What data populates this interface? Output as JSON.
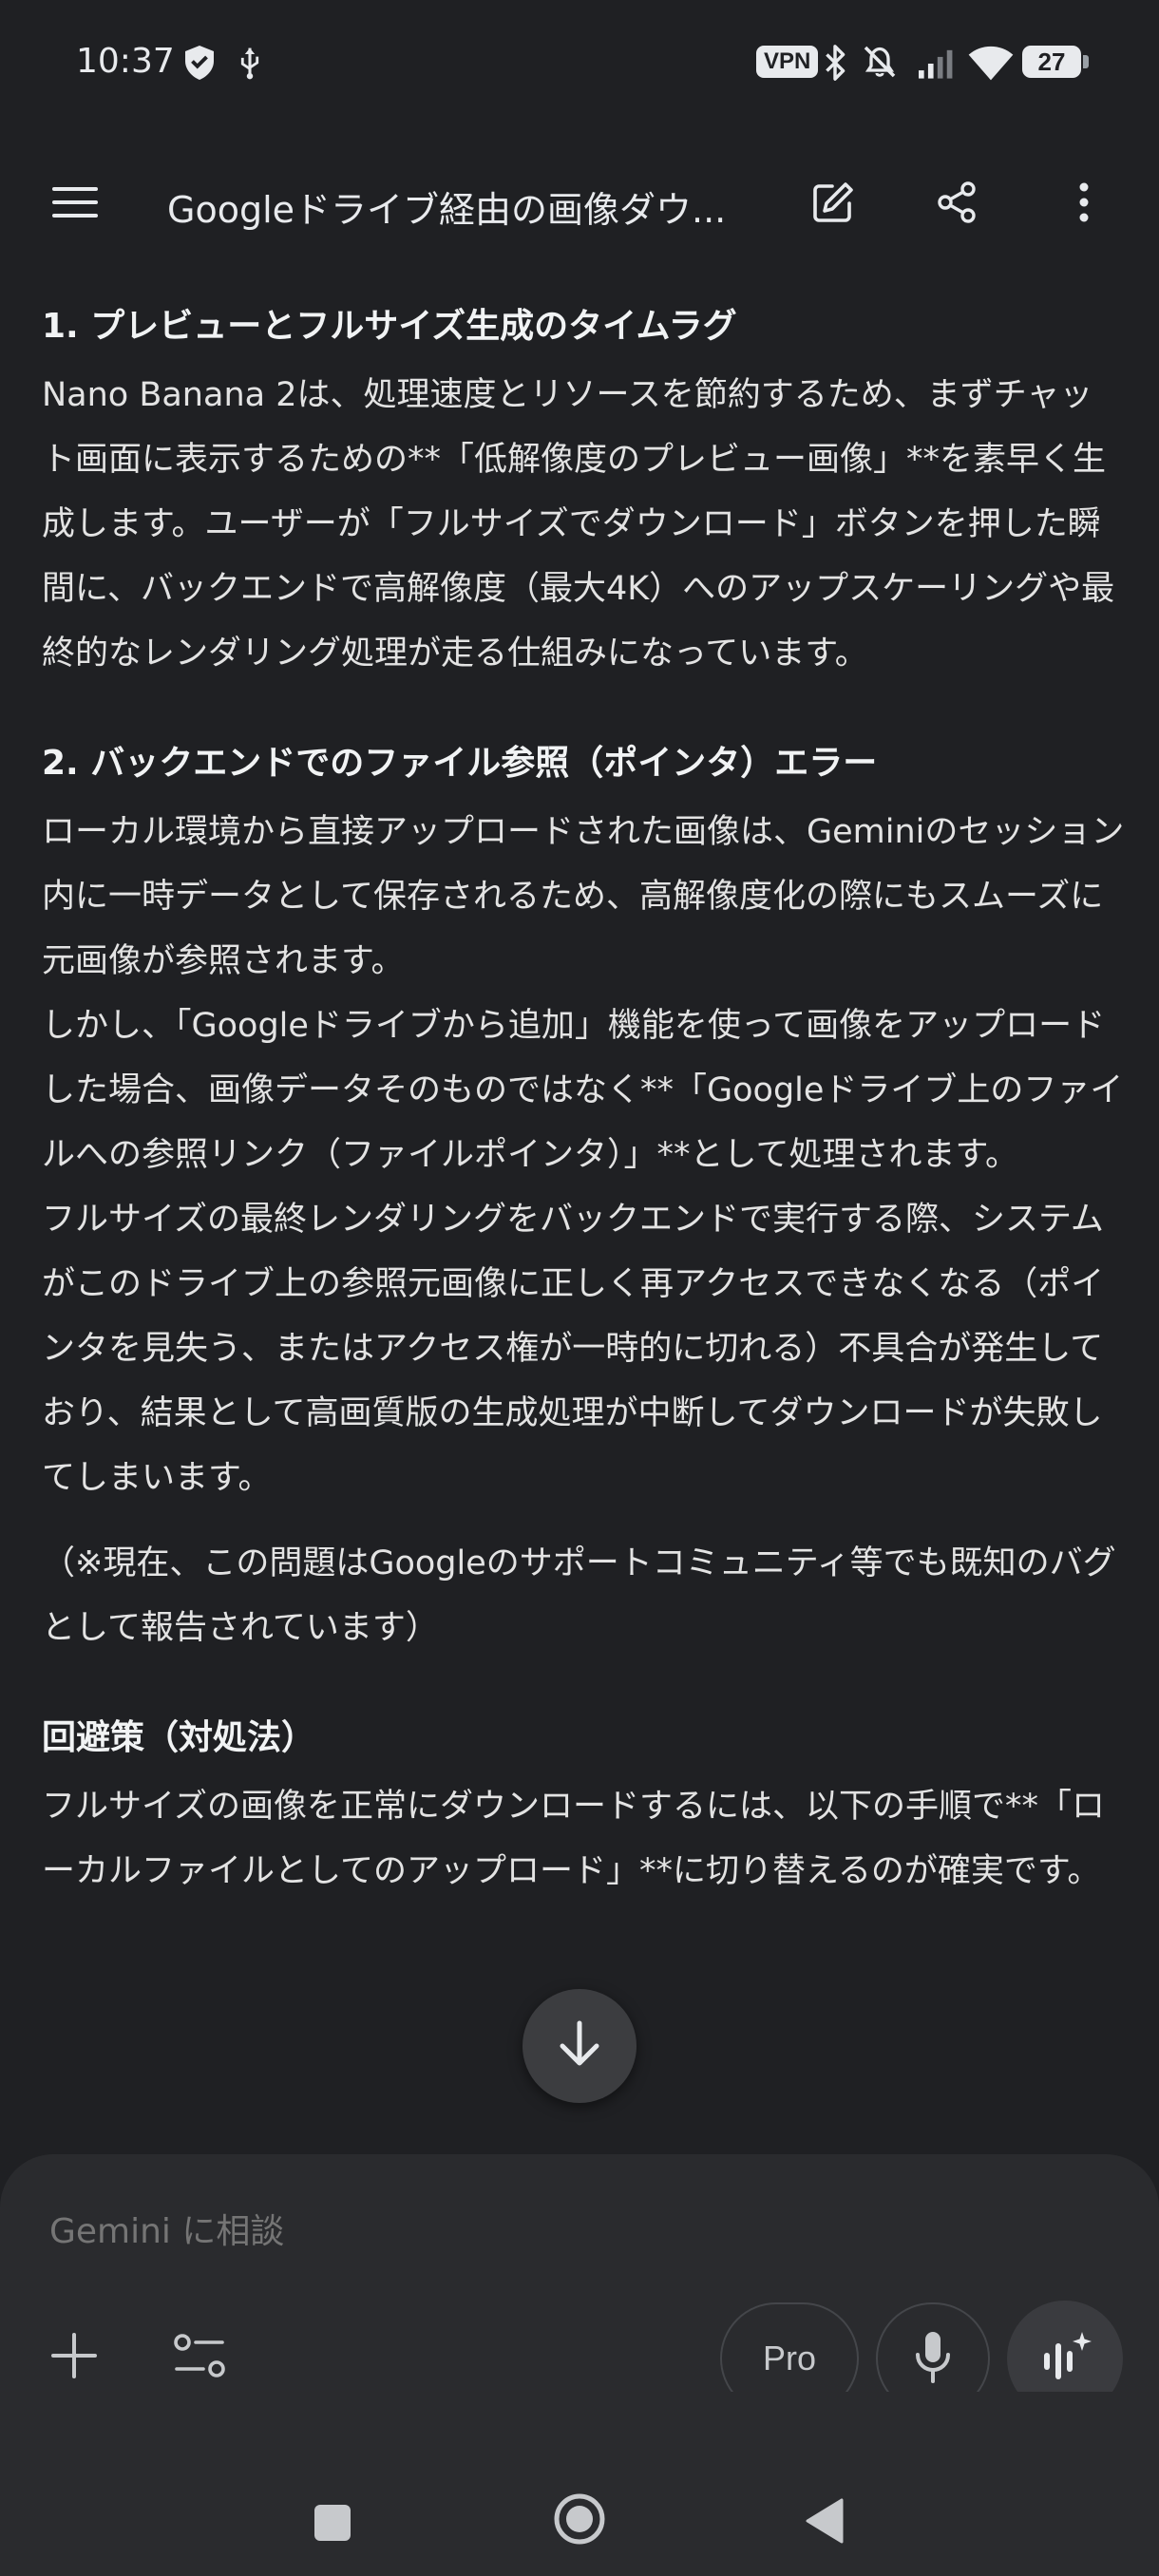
{
  "status_bar": {
    "time": "10:37",
    "vpn": "VPN",
    "battery": "27"
  },
  "app_bar": {
    "title": "Googleドライブ経由の画像ダウ..."
  },
  "content": {
    "section1": {
      "heading": "1. プレビューとフルサイズ生成のタイムラグ",
      "paragraph": "Nano Banana 2は、処理速度とリソースを節約するため、まずチャット画面に表示するための**「低解像度のプレビュー画像」**を素早く生成します。ユーザーが「フルサイズでダウンロード」ボタンを押した瞬間に、バックエンドで高解像度（最大4K）へのアップスケーリングや最終的なレンダリング処理が走る仕組みになっています。"
    },
    "section2": {
      "heading": "2. バックエンドでのファイル参照（ポインタ）エラー",
      "paragraph1": "ローカル環境から直接アップロードされた画像は、Geminiのセッション内に一時データとして保存されるため、高解像度化の際にもスムーズに元画像が参照されます。",
      "paragraph2": "しかし、「Googleドライブから追加」機能を使って画像をアップロードした場合、画像データそのものではなく**「Googleドライブ上のファイルへの参照リンク（ファイルポインタ）」**として処理されます。",
      "paragraph3": "フルサイズの最終レンダリングをバックエンドで実行する際、システムがこのドライブ上の参照元画像に正しく再アクセスできなくなる（ポインタを見失う、またはアクセス権が一時的に切れる）不具合が発生しており、結果として高画質版の生成処理が中断してダウンロードが失敗してしまいます。",
      "note": "（※現在、この問題はGoogleのサポートコミュニティ等でも既知のバグとして報告されています）"
    },
    "section3": {
      "heading": "回避策（対処法）",
      "paragraph": "フルサイズの画像を正常にダウンロードするには、以下の手順で**「ローカルファイルとしてのアップロード」**に切り替えるのが確実です。"
    }
  },
  "composer": {
    "placeholder": "Gemini に相談",
    "pro_label": "Pro"
  },
  "icons": {
    "menu": "menu-icon",
    "edit": "edit-icon",
    "share": "share-icon",
    "more": "more-vert-icon",
    "add": "plus-icon",
    "tools": "tools-icon",
    "mic": "mic-icon",
    "live": "live-icon",
    "scroll_down": "arrow-down-icon"
  },
  "colors": {
    "background": "#1f2023",
    "text": "#e8eaed",
    "surface": "#2a2b2e"
  }
}
